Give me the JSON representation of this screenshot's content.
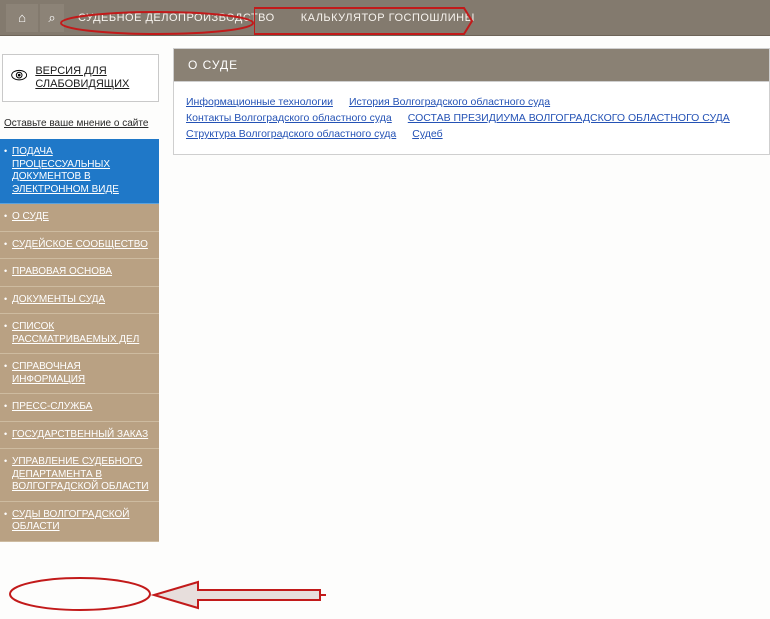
{
  "topbar": {
    "home_icon_alt": "home",
    "items": [
      {
        "label": "СУДЕБНОЕ ДЕЛОПРОИЗВОДСТВО"
      },
      {
        "label": "КАЛЬКУЛЯТОР ГОСПОШЛИНЫ"
      }
    ]
  },
  "accessibility": {
    "label": "ВЕРСИЯ ДЛЯ СЛАБОВИДЯЩИХ"
  },
  "feedback_label": "Оставьте ваше мнение о сайте",
  "sidemenu": [
    {
      "label": "ПОДАЧА ПРОЦЕССУАЛЬНЫХ ДОКУМЕНТОВ В ЭЛЕКТРОННОМ ВИДЕ",
      "active": true
    },
    {
      "label": "О СУДЕ"
    },
    {
      "label": "СУДЕЙСКОЕ СООБЩЕСТВО"
    },
    {
      "label": "ПРАВОВАЯ ОСНОВА"
    },
    {
      "label": "ДОКУМЕНТЫ СУДА"
    },
    {
      "label": "СПИСОК РАССМАТРИВАЕМЫХ ДЕЛ"
    },
    {
      "label": "СПРАВОЧНАЯ ИНФОРМАЦИЯ"
    },
    {
      "label": "ПРЕСС-СЛУЖБА"
    },
    {
      "label": "ГОСУДАРСТВЕННЫЙ ЗАКАЗ"
    },
    {
      "label": "УПРАВЛЕНИЕ СУДЕБНОГО ДЕПАРТАМЕНТА В ВОЛГОГРАДСКОЙ ОБЛАСТИ"
    },
    {
      "label": "СУДЫ ВОЛГОГРАДСКОЙ ОБЛАСТИ"
    }
  ],
  "page_title": "О СУДЕ",
  "sublinks": [
    "Информационные технологии",
    "История Волгоградского областного суда",
    "Контакты Волгоградского областного суда",
    "СОСТАВ ПРЕЗИДИУМА ВОЛГОГРАДСКОГО ОБЛАСТНОГО СУДА",
    "Структура Волгоградского областного суда",
    "Судеб"
  ]
}
